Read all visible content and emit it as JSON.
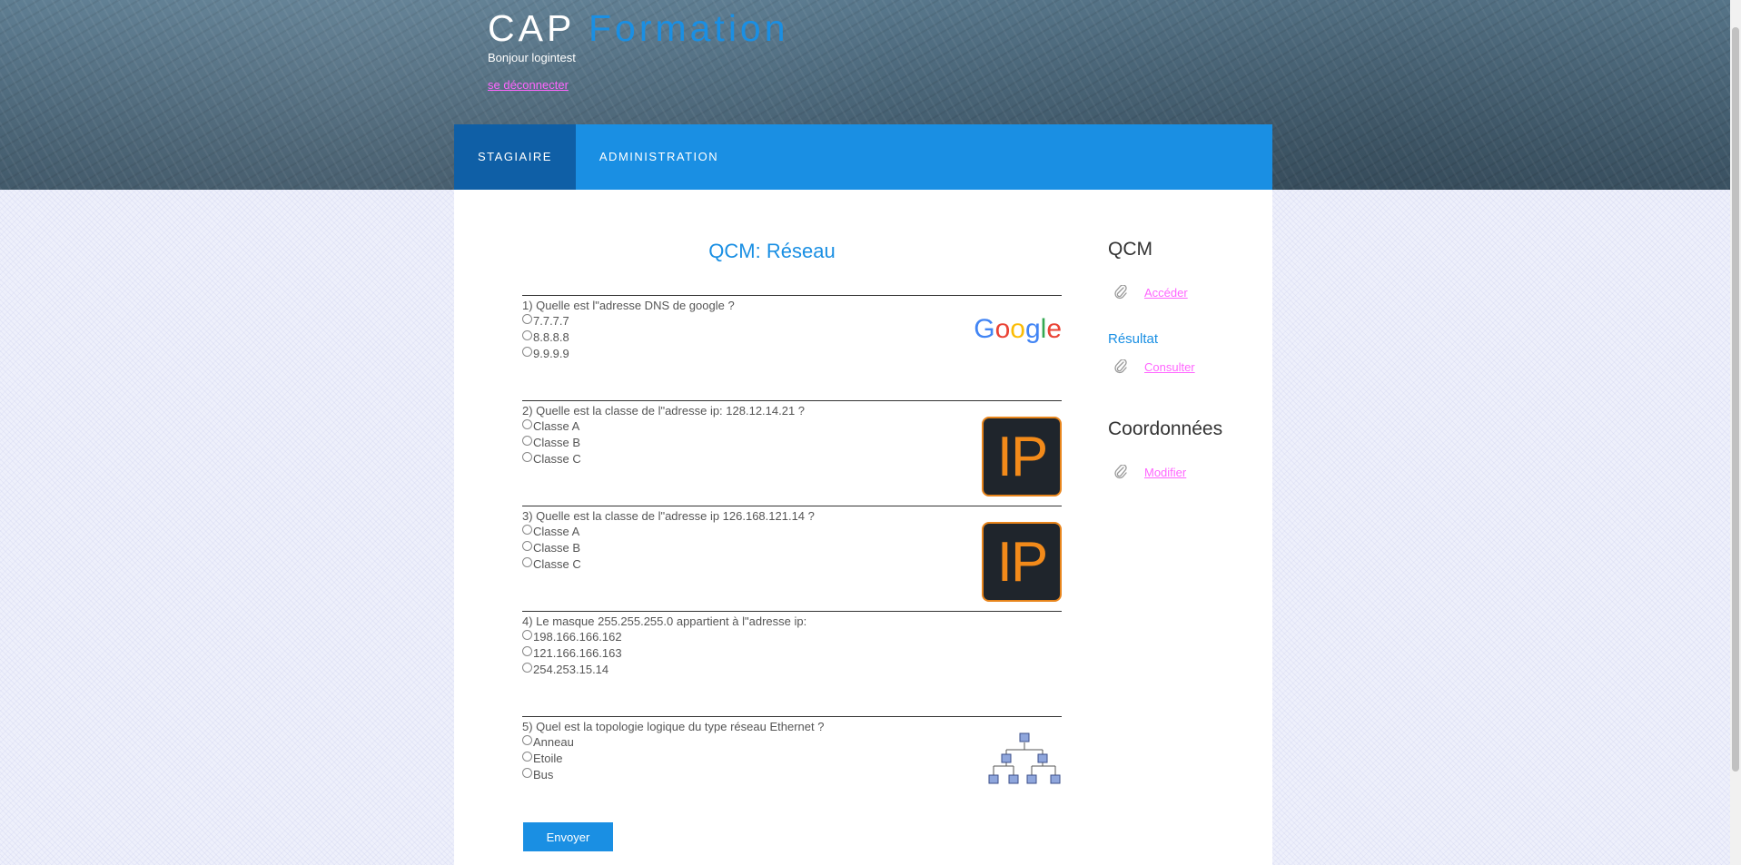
{
  "header": {
    "title_main": "CAP",
    "title_accent": "Formation",
    "greeting": "Bonjour logintest",
    "logout_label": "se déconnecter"
  },
  "nav": {
    "items": [
      {
        "label": "STAGIAIRE",
        "active": true
      },
      {
        "label": "ADMINISTRATION",
        "active": false
      }
    ]
  },
  "qcm": {
    "title": "QCM: Réseau",
    "questions": [
      {
        "text": "1) Quelle est l\"adresse DNS de google ?",
        "options": [
          "7.7.7.7",
          "8.8.8.8",
          "9.9.9.9"
        ],
        "image": "google-logo"
      },
      {
        "text": "2) Quelle est la classe de l\"adresse ip: 128.12.14.21 ?",
        "options": [
          "Classe A",
          "Classe B",
          "Classe C"
        ],
        "image": "ip-icon"
      },
      {
        "text": "3) Quelle est la classe de l\"adresse ip 126.168.121.14 ?",
        "options": [
          "Classe A",
          "Classe B",
          "Classe C"
        ],
        "image": "ip-icon"
      },
      {
        "text": "4) Le masque 255.255.255.0 appartient à l\"adresse ip:",
        "options": [
          "198.166.166.162",
          "121.166.166.163",
          "254.253.15.14"
        ],
        "image": null
      },
      {
        "text": "5) Quel est la topologie logique du type réseau Ethernet ?",
        "options": [
          "Anneau",
          "Etoile",
          "Bus"
        ],
        "image": "network-tree-icon"
      }
    ],
    "ip_glyph": "IP",
    "google_letters": [
      "G",
      "o",
      "o",
      "g",
      "l",
      "e"
    ],
    "submit_label": "Envoyer"
  },
  "sidebar": {
    "qcm_heading": "QCM",
    "qcm_link": "Accéder",
    "result_heading": "Résultat",
    "result_link": "Consulter",
    "coords_heading": "Coordonnées",
    "coords_link": "Modifier"
  },
  "colors": {
    "accent": "#1a8fe3",
    "nav_active": "#0f5fa6",
    "link": "#ff66ff",
    "ip_orange": "#f28a1a",
    "google": [
      "#4285F4",
      "#EA4335",
      "#FBBC05",
      "#4285F4",
      "#34A853",
      "#EA4335"
    ]
  }
}
